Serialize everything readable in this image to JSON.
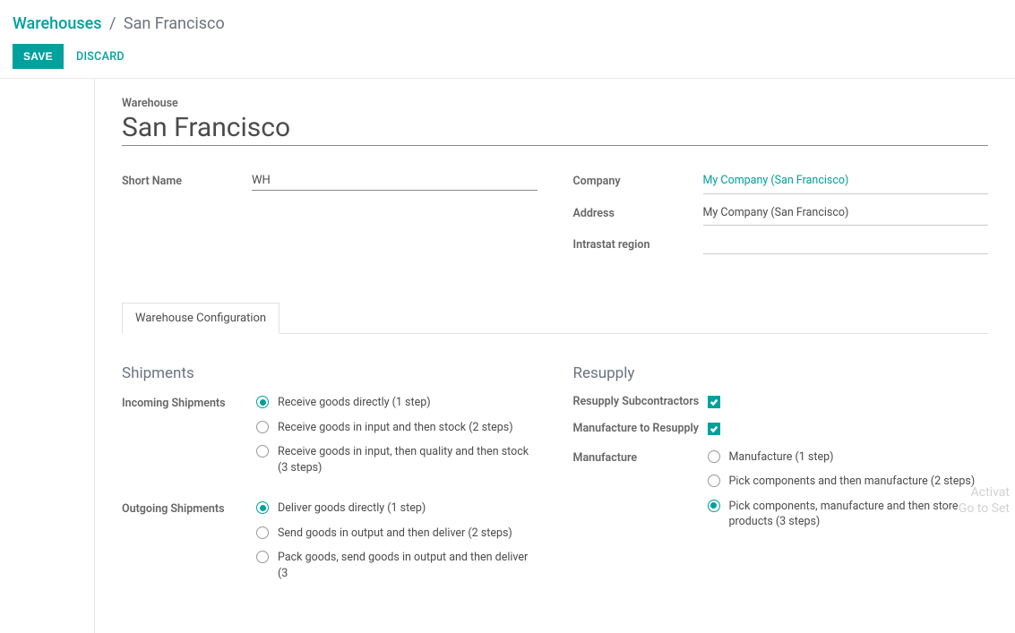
{
  "breadcrumb": {
    "parent": "Warehouses",
    "current": "San Francisco"
  },
  "actions": {
    "save": "SAVE",
    "discard": "DISCARD"
  },
  "form": {
    "warehouse_label": "Warehouse",
    "warehouse_value": "San Francisco",
    "short_name_label": "Short Name",
    "short_name_value": "WH",
    "company_label": "Company",
    "company_value": "My Company (San Francisco)",
    "address_label": "Address",
    "address_value": "My Company (San Francisco)",
    "intrastat_label": "Intrastat region",
    "intrastat_value": ""
  },
  "tab": {
    "label": "Warehouse Configuration"
  },
  "shipments": {
    "title": "Shipments",
    "incoming_label": "Incoming Shipments",
    "incoming": {
      "selected": 0,
      "options": [
        "Receive goods directly (1 step)",
        "Receive goods in input and then stock (2 steps)",
        "Receive goods in input, then quality and then stock (3 steps)"
      ]
    },
    "outgoing_label": "Outgoing Shipments",
    "outgoing": {
      "selected": 0,
      "options": [
        "Deliver goods directly (1 step)",
        "Send goods in output and then deliver (2 steps)",
        "Pack goods, send goods in output and then deliver (3"
      ]
    }
  },
  "resupply": {
    "title": "Resupply",
    "subcontractors_label": "Resupply Subcontractors",
    "subcontractors_checked": true,
    "manufacture_resupply_label": "Manufacture to Resupply",
    "manufacture_resupply_checked": true,
    "manufacture_label": "Manufacture",
    "manufacture": {
      "selected": 2,
      "options": [
        "Manufacture (1 step)",
        "Pick components and then manufacture (2 steps)",
        "Pick components, manufacture and then store products (3 steps)"
      ]
    }
  },
  "watermark": {
    "line1": "Activat",
    "line2": "Go to Set"
  }
}
